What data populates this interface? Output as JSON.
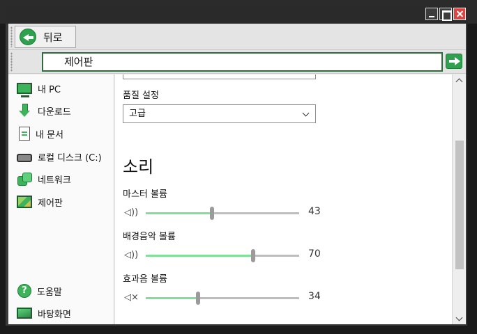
{
  "window": {
    "controls": [
      "minimize",
      "maximize",
      "close"
    ]
  },
  "toolbar": {
    "back_label": "뒤로",
    "back_icon": "back-arrow-icon"
  },
  "address": {
    "value": "제어판",
    "go_icon": "go-arrow-icon"
  },
  "sidebar": {
    "items": [
      {
        "label": "내 PC",
        "icon": "computer-icon"
      },
      {
        "label": "다운로드",
        "icon": "download-icon"
      },
      {
        "label": "내 문서",
        "icon": "document-icon"
      },
      {
        "label": "로컬 디스크 (C:)",
        "icon": "disk-icon"
      },
      {
        "label": "네트워크",
        "icon": "network-icon"
      },
      {
        "label": "제어판",
        "icon": "control-panel-icon"
      }
    ],
    "bottom": [
      {
        "label": "도움말",
        "icon": "help-icon"
      },
      {
        "label": "바탕화면",
        "icon": "desktop-icon"
      }
    ]
  },
  "settings": {
    "quality": {
      "label": "품질 설정",
      "value": "고급"
    },
    "sound_title": "소리",
    "volumes": [
      {
        "label": "마스터 볼륨",
        "icon_text": "◁))",
        "value": 43,
        "display": "43"
      },
      {
        "label": "배경음악 볼륨",
        "icon_text": "◁))",
        "value": 70,
        "display": "70"
      },
      {
        "label": "효과음 볼륨",
        "icon_text": "◁×",
        "value": 34,
        "display": "34"
      }
    ]
  },
  "colors": {
    "accent": "#3db35c",
    "slider_fill": "#7fe09a",
    "titlebar": "#2b2b2b"
  }
}
